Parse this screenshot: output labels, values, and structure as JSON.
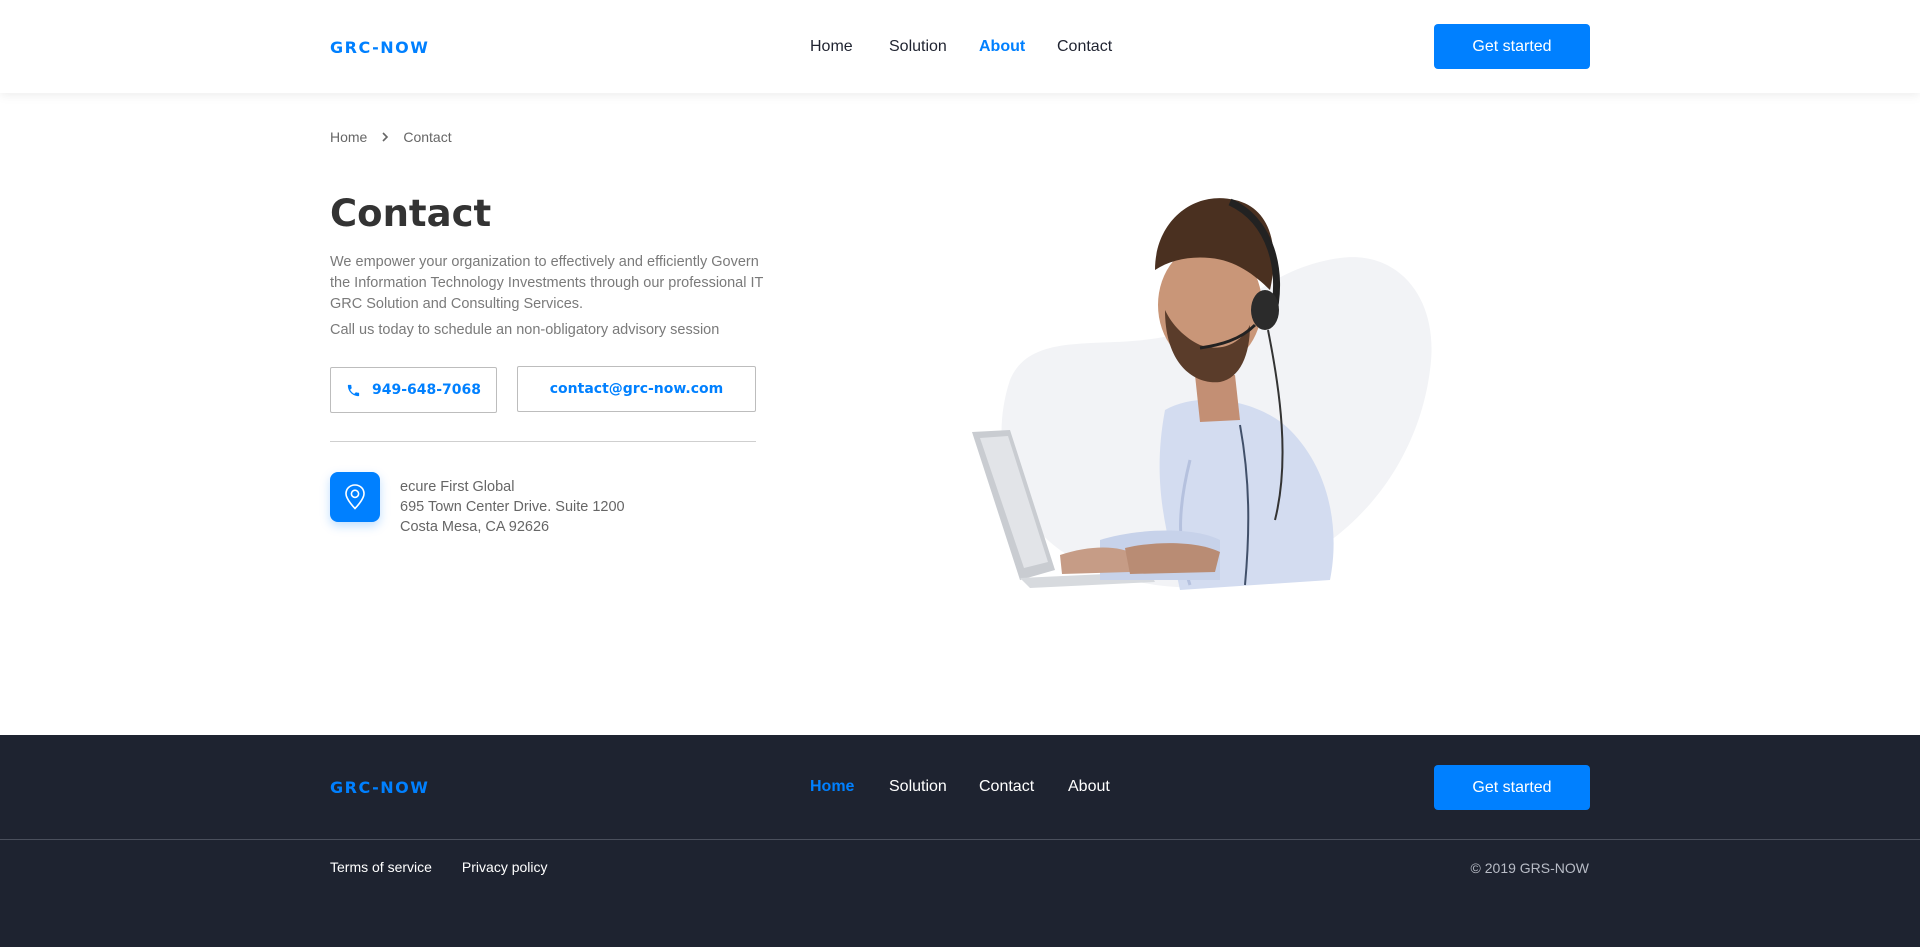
{
  "header": {
    "logo": "GRC-NOW",
    "nav": [
      {
        "label": "Home",
        "active": false
      },
      {
        "label": "Solution",
        "active": false
      },
      {
        "label": "About",
        "active": true
      },
      {
        "label": "Contact",
        "active": false
      }
    ],
    "cta_label": "Get started"
  },
  "breadcrumb": {
    "home": "Home",
    "separator": "›",
    "current": "Contact"
  },
  "main": {
    "title": "Contact",
    "description": "We empower your organization to effectively and efficiently Govern the Information Technology Investments through our professional IT GRC Solution and Consulting Services.",
    "call_to_action": "Call us today to schedule an non-obligatory advisory session",
    "phone": "949-648-7068",
    "email": "contact@grc-now.com",
    "address": {
      "line1": "ecure First Global",
      "line2": "695 Town Center Drive. Suite 1200",
      "line3": "Costa Mesa, CA 92626"
    }
  },
  "footer": {
    "logo": "GRC-NOW",
    "nav": [
      {
        "label": "Home",
        "active": true
      },
      {
        "label": "Solution",
        "active": false
      },
      {
        "label": "Contact",
        "active": false
      },
      {
        "label": "About",
        "active": false
      }
    ],
    "cta_label": "Get started",
    "links": {
      "terms": "Terms of service",
      "privacy": "Privacy policy"
    },
    "copyright": "© 2019 GRS-NOW"
  },
  "colors": {
    "accent": "#0080ff",
    "footer_bg": "#1e2330",
    "text_dark": "#333333",
    "text_muted": "#7a7a7a"
  },
  "icons": {
    "phone": "phone-icon",
    "location": "location-pin-icon",
    "breadcrumb_separator": "chevron-right-icon"
  }
}
